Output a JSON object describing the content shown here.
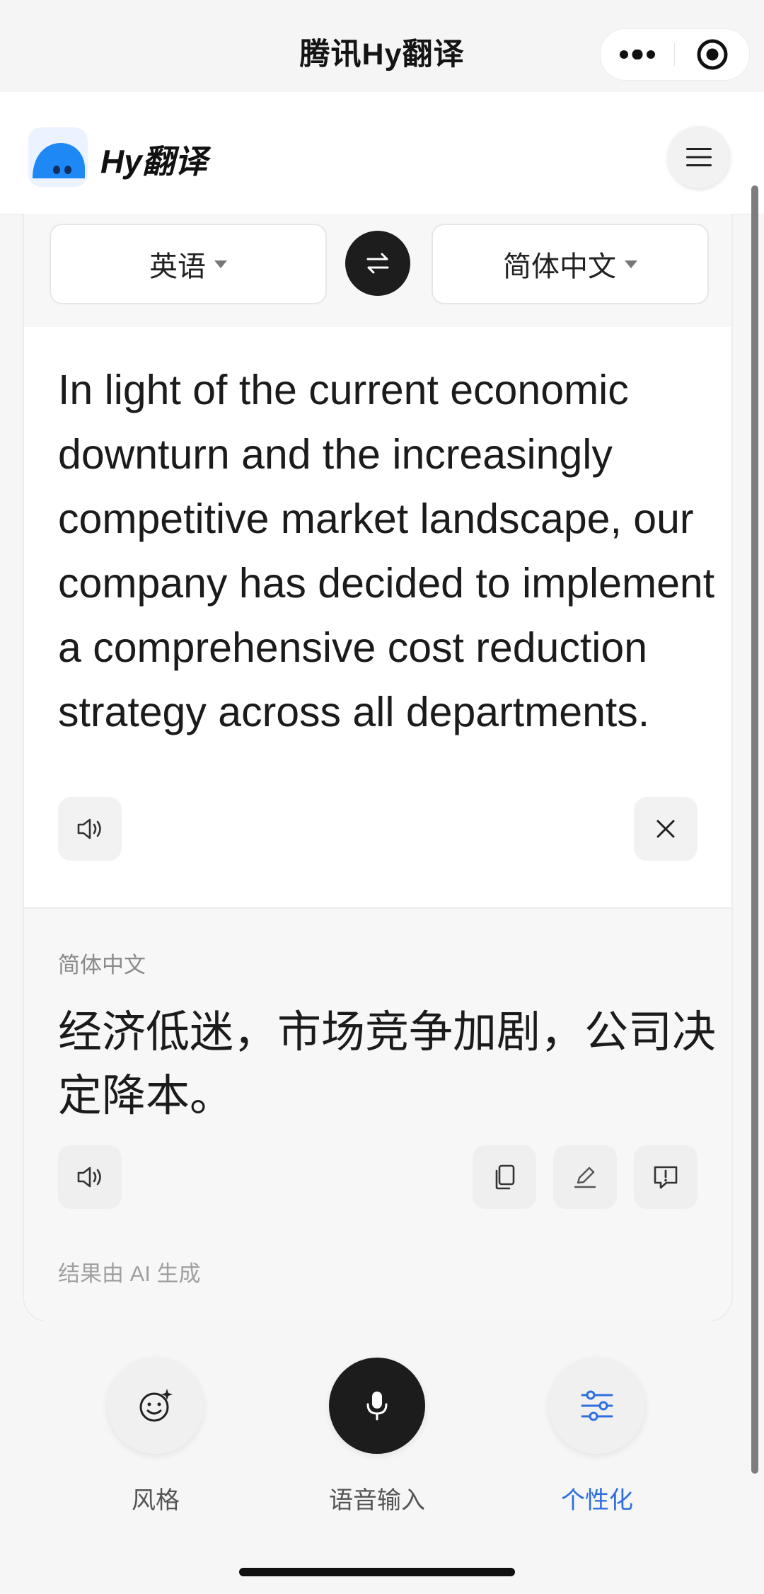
{
  "mini_program": {
    "title": "腾讯Hy翻译",
    "more_icon": "more-dots-icon",
    "close_icon": "target-circle-icon"
  },
  "app": {
    "brand": "Hy翻译",
    "logo_icon": "blue-blob-logo",
    "menu_icon": "hamburger-menu-icon"
  },
  "languages": {
    "source": "英语",
    "target": "简体中文",
    "swap_icon": "swap-arrows-icon"
  },
  "source": {
    "text": "In light of the current economic downturn and the increasingly competitive market landscape, our company has decided to implement a comprehensive cost reduction strategy across all departments.",
    "speak_icon": "speaker-icon",
    "clear_icon": "close-icon"
  },
  "translation": {
    "language_label": "简体中文",
    "text": "经济低迷，市场竞争加剧，公司决定降本。",
    "ai_note": "结果由 AI 生成",
    "icons": [
      "speaker-icon",
      "copy-icon",
      "edit-icon",
      "feedback-icon"
    ]
  },
  "bottom_actions": [
    {
      "label": "风格",
      "icon": "smile-sparkle-icon"
    },
    {
      "label": "语音输入",
      "icon": "microphone-icon"
    },
    {
      "label": "个性化",
      "icon": "sliders-icon"
    }
  ],
  "colors": {
    "accent": "#2d6fe0",
    "dark_button": "#1c1c1c",
    "logo_blue": "#1e88f5"
  }
}
